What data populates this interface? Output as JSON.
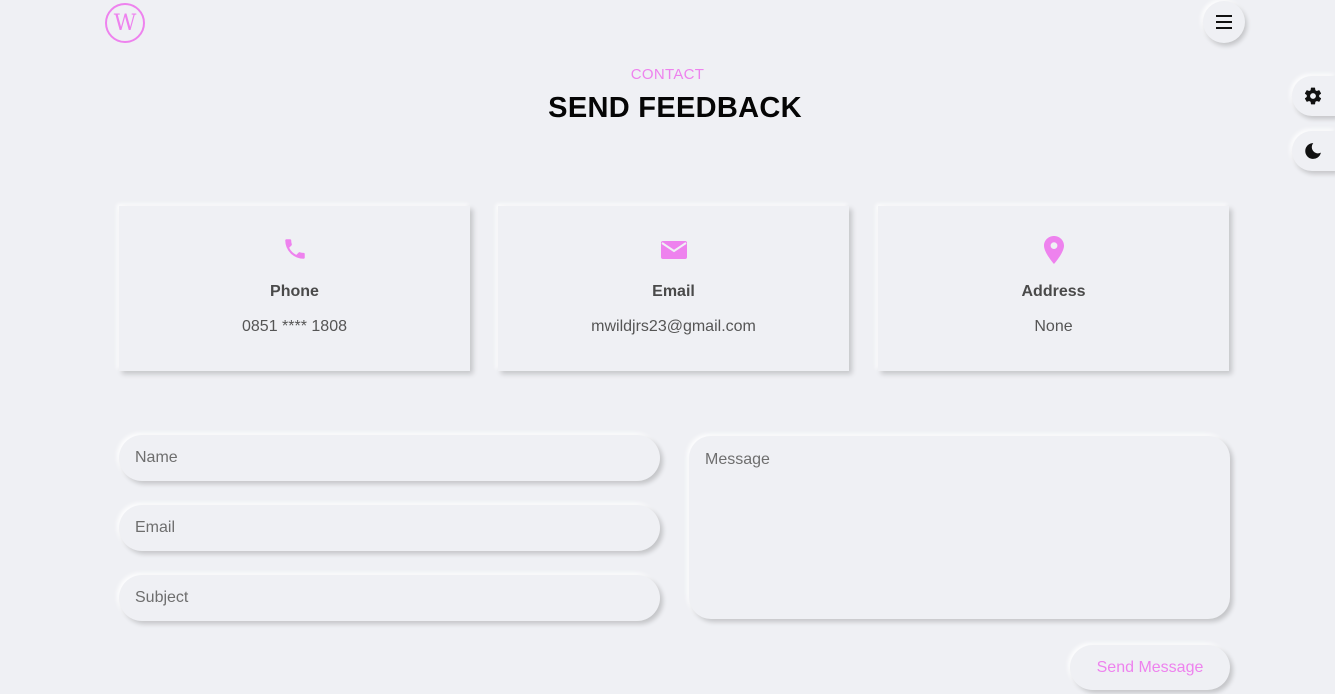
{
  "header": {
    "logo_letter": "W",
    "logo_icon": "w-logo-icon",
    "menu_icon": "hamburger-menu-icon"
  },
  "side_controls": {
    "settings_icon": "gear-icon",
    "theme_icon": "moon-icon"
  },
  "section": {
    "subtitle": "CONTACT",
    "title": "SEND FEEDBACK"
  },
  "cards": [
    {
      "icon": "phone-icon",
      "label": "Phone",
      "value": "0851 **** 1808"
    },
    {
      "icon": "envelope-icon",
      "label": "Email",
      "value": "mwildjrs23@gmail.com"
    },
    {
      "icon": "map-marker-icon",
      "label": "Address",
      "value": "None"
    }
  ],
  "form": {
    "name_placeholder": "Name",
    "email_placeholder": "Email",
    "subject_placeholder": "Subject",
    "message_placeholder": "Message",
    "name_value": "",
    "email_value": "",
    "subject_value": "",
    "message_value": "",
    "submit_label": "Send Message"
  },
  "colors": {
    "accent": "#ee82ee",
    "background": "#eff0f4",
    "heading": "#050505"
  }
}
